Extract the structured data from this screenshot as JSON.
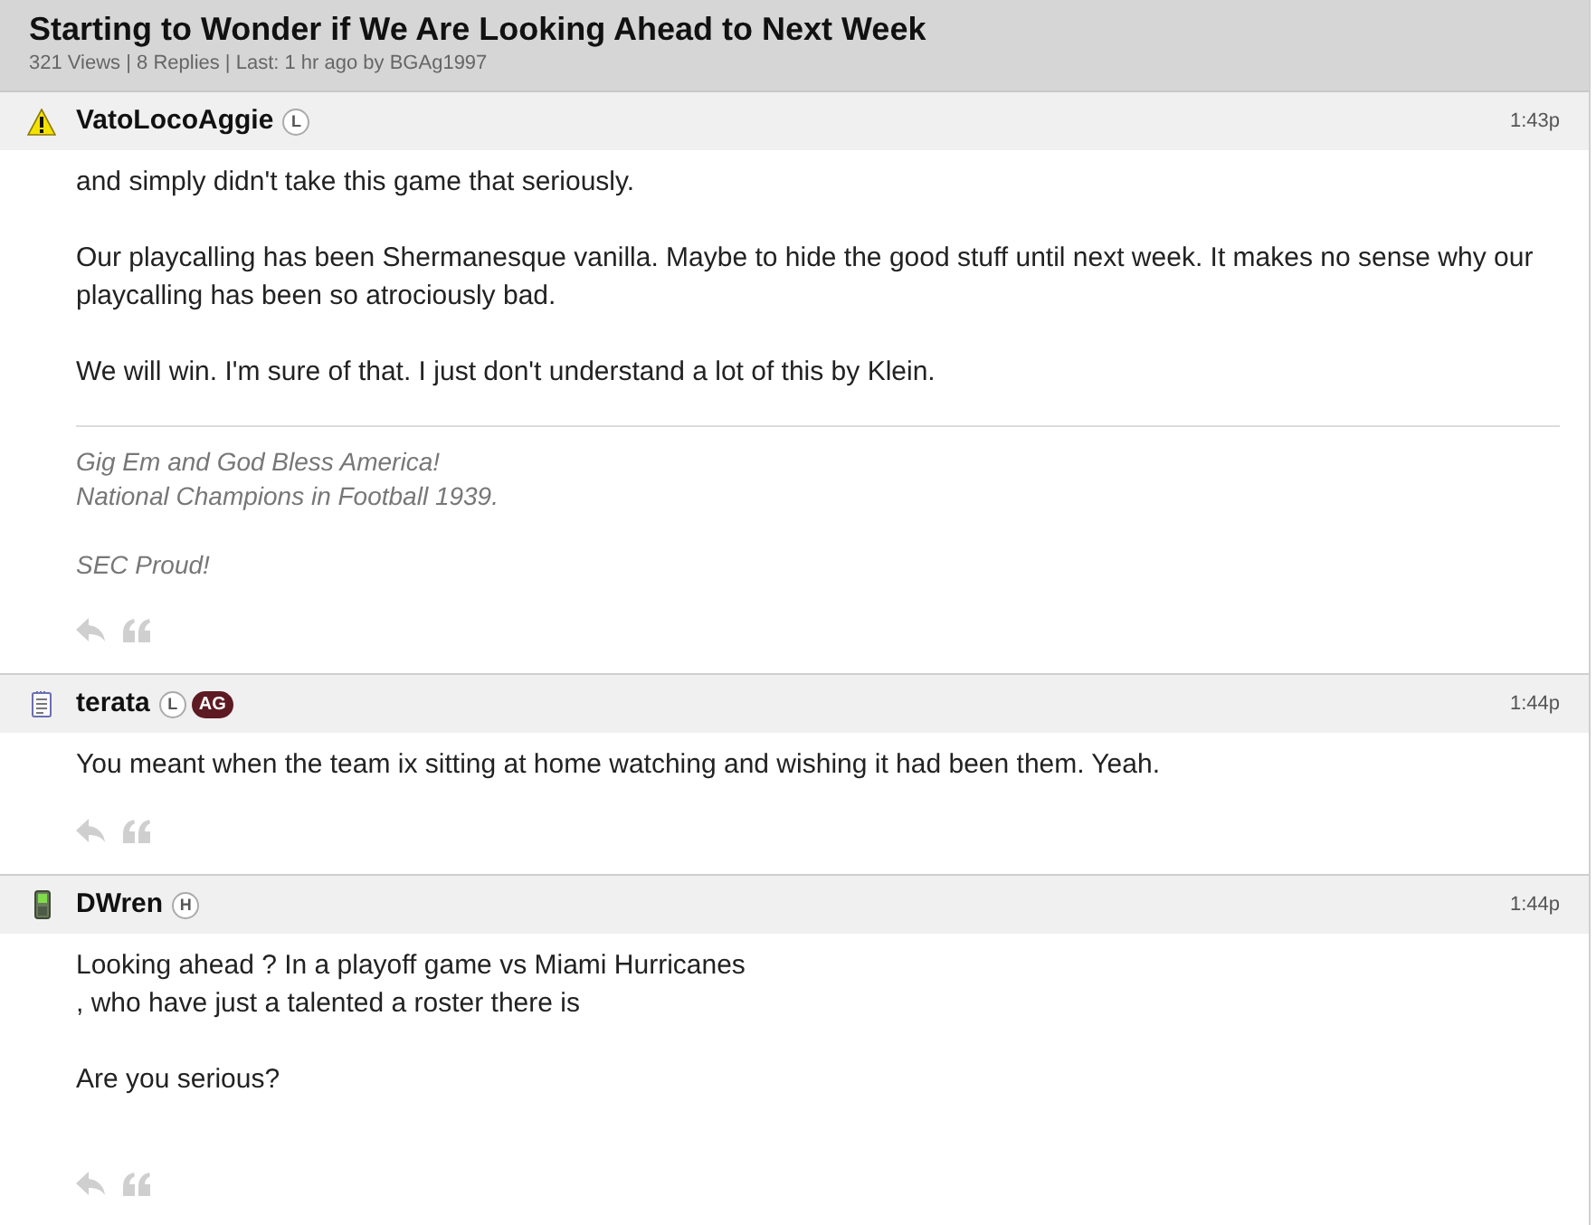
{
  "thread": {
    "title": "Starting to Wonder if We Are Looking Ahead to Next Week",
    "stats": "321 Views | 8 Replies | Last: 1 hr ago by BGAg1997"
  },
  "posts": [
    {
      "kind": "warning",
      "username": "VatoLocoAggie",
      "badges": [
        {
          "text": "L",
          "kind": "outline"
        }
      ],
      "time": "1:43p",
      "body": [
        [
          "and simply didn't take this game that seriously."
        ],
        [
          "Our playcalling has been Shermanesque vanilla. Maybe to hide the good stuff until next week. It makes no sense why our playcalling has been so atrociously bad."
        ],
        [
          "We will win. I'm sure of that. I just don't understand a lot of this by Klein."
        ]
      ],
      "signature": [
        [
          "Gig Em and God Bless America!",
          "National Champions in Football 1939."
        ],
        [
          "SEC Proud!"
        ]
      ]
    },
    {
      "kind": "note",
      "username": "terata",
      "badges": [
        {
          "text": "L",
          "kind": "outline"
        },
        {
          "text": "AG",
          "kind": "filled"
        }
      ],
      "time": "1:44p",
      "body": [
        [
          "You meant when the team ix sitting at home watching and wishing it had been them. Yeah."
        ]
      ]
    },
    {
      "kind": "phone",
      "username": "DWren",
      "badges": [
        {
          "text": "H",
          "kind": "outline"
        }
      ],
      "time": "1:44p",
      "body": [
        [
          "Looking ahead ? In a playoff game vs Miami Hurricanes",
          ", who have just a talented a roster there is"
        ],
        [
          "Are you serious?"
        ]
      ]
    }
  ]
}
